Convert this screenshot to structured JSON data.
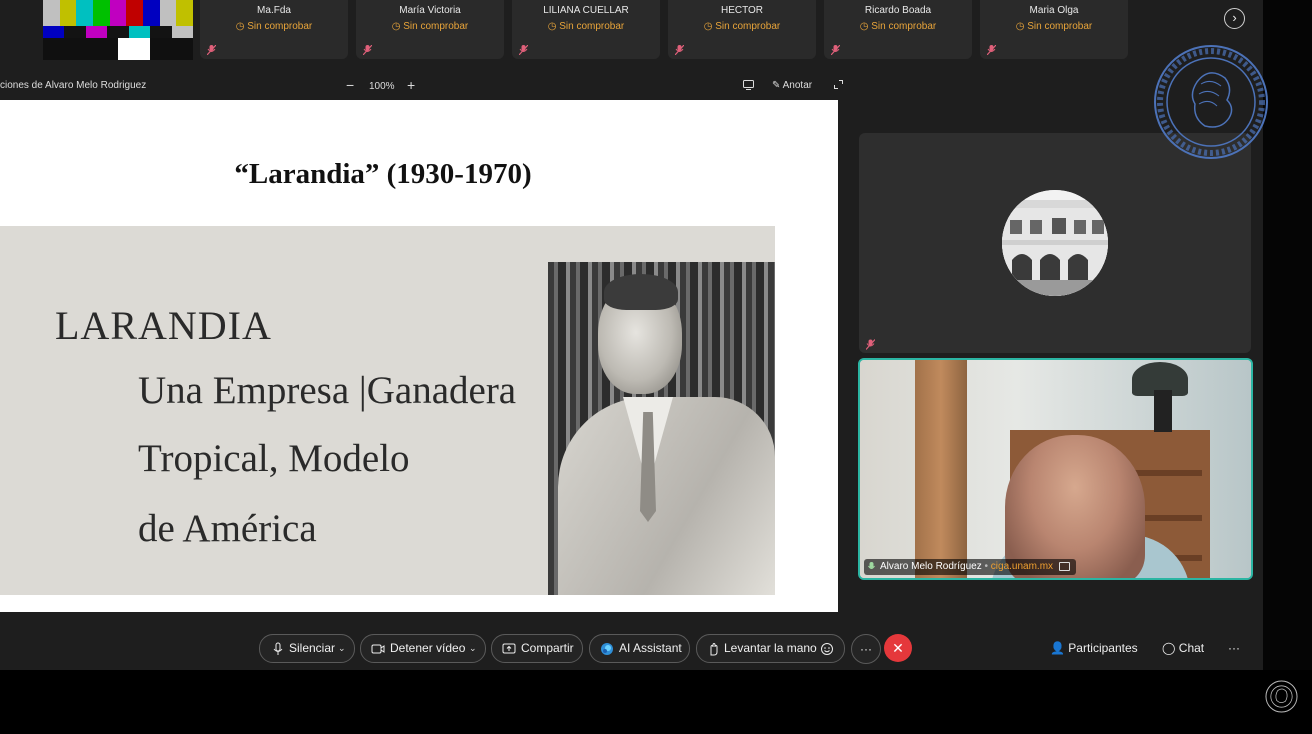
{
  "filmstrip": {
    "tiles": [
      {
        "name": "Ma.Fda",
        "status": "Sin comprobar"
      },
      {
        "name": "María Victoria",
        "status": "Sin comprobar"
      },
      {
        "name": "LILIANA CUELLAR",
        "status": "Sin comprobar"
      },
      {
        "name": "HECTOR",
        "status": "Sin comprobar"
      },
      {
        "name": "Ricardo Boada",
        "status": "Sin comprobar"
      },
      {
        "name": "Maria Olga",
        "status": "Sin comprobar"
      }
    ],
    "next_icon": "chevron-right-icon"
  },
  "share": {
    "title": "ciones de Alvaro Melo Rodriguez",
    "zoom_minus": "−",
    "zoom_level": "100%",
    "zoom_plus": "+",
    "annotate_label": "Anotar"
  },
  "slide": {
    "title": "“Larandia” (1930-1970)",
    "photo_lines": [
      "LARANDIA",
      "Una Empresa |Ganadera",
      "Tropical, Modelo",
      "de América"
    ]
  },
  "video": {
    "speaker_name": "Alvaro Melo Rodríguez",
    "speaker_separator": "•",
    "speaker_org": "ciga.unam.mx"
  },
  "toolbar": {
    "mute_label": "Silenciar",
    "video_label": "Detener vídeo",
    "share_label": "Compartir",
    "assistant_label": "AI Assistant",
    "raise_hand_label": "Levantar la mano",
    "more_label": "···",
    "participants_label": "Participantes",
    "chat_label": "Chat",
    "overflow_label": "···"
  },
  "colors": {
    "accent_status": "#e8a43a",
    "active_speaker_border": "#2bb5a3",
    "end_call": "#e5383b",
    "seal_blue": "#4c72b8"
  }
}
